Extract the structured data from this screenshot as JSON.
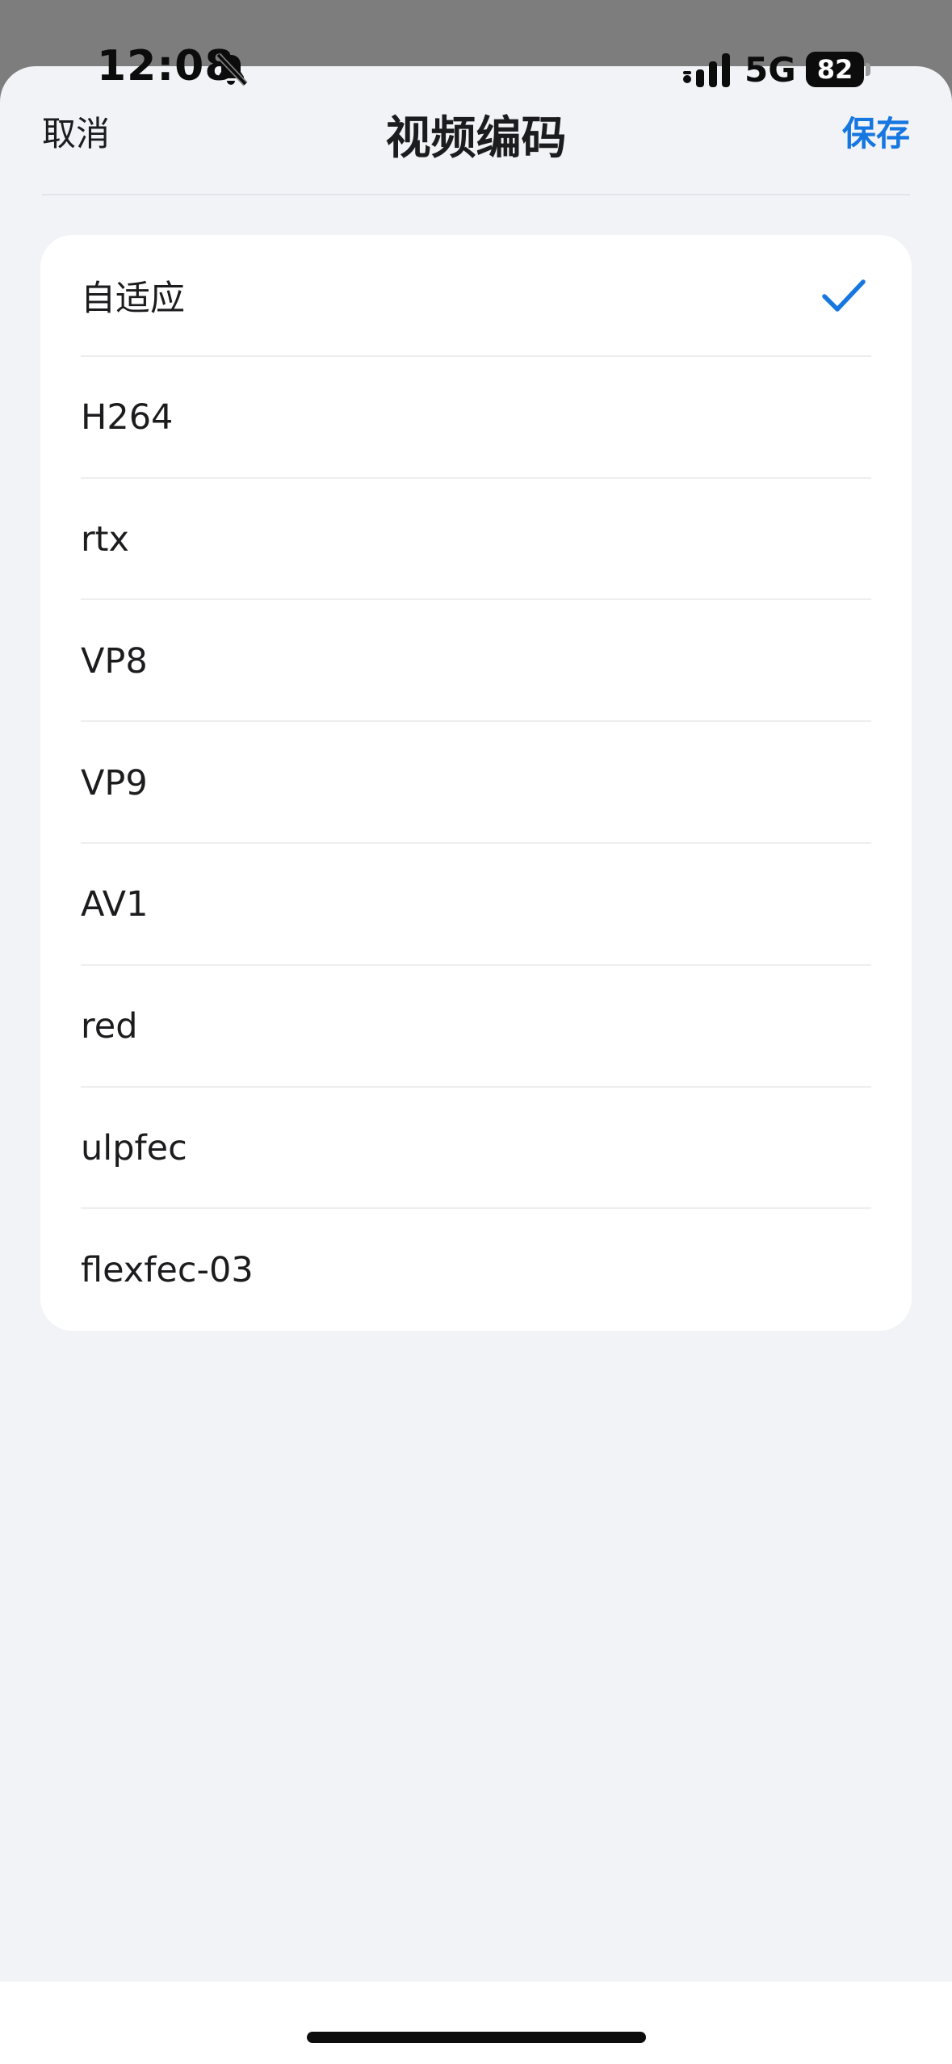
{
  "status_bar": {
    "time": "12:08",
    "network": "5G",
    "battery": "82",
    "icons": [
      "bell-slash-icon",
      "signal-icon",
      "battery-icon"
    ]
  },
  "nav": {
    "cancel_label": "取消",
    "title": "视频编码",
    "save_label": "保存"
  },
  "options": [
    {
      "label": "自适应",
      "selected": true
    },
    {
      "label": "H264",
      "selected": false
    },
    {
      "label": "rtx",
      "selected": false
    },
    {
      "label": "VP8",
      "selected": false
    },
    {
      "label": "VP9",
      "selected": false
    },
    {
      "label": "AV1",
      "selected": false
    },
    {
      "label": "red",
      "selected": false
    },
    {
      "label": "ulpfec",
      "selected": false
    },
    {
      "label": "flexfec-03",
      "selected": false
    }
  ],
  "colors": {
    "accent": "#1677e0",
    "sheet_background": "#f2f3f7",
    "dimmed_background": "#7d7d7d",
    "card": "#ffffff"
  }
}
